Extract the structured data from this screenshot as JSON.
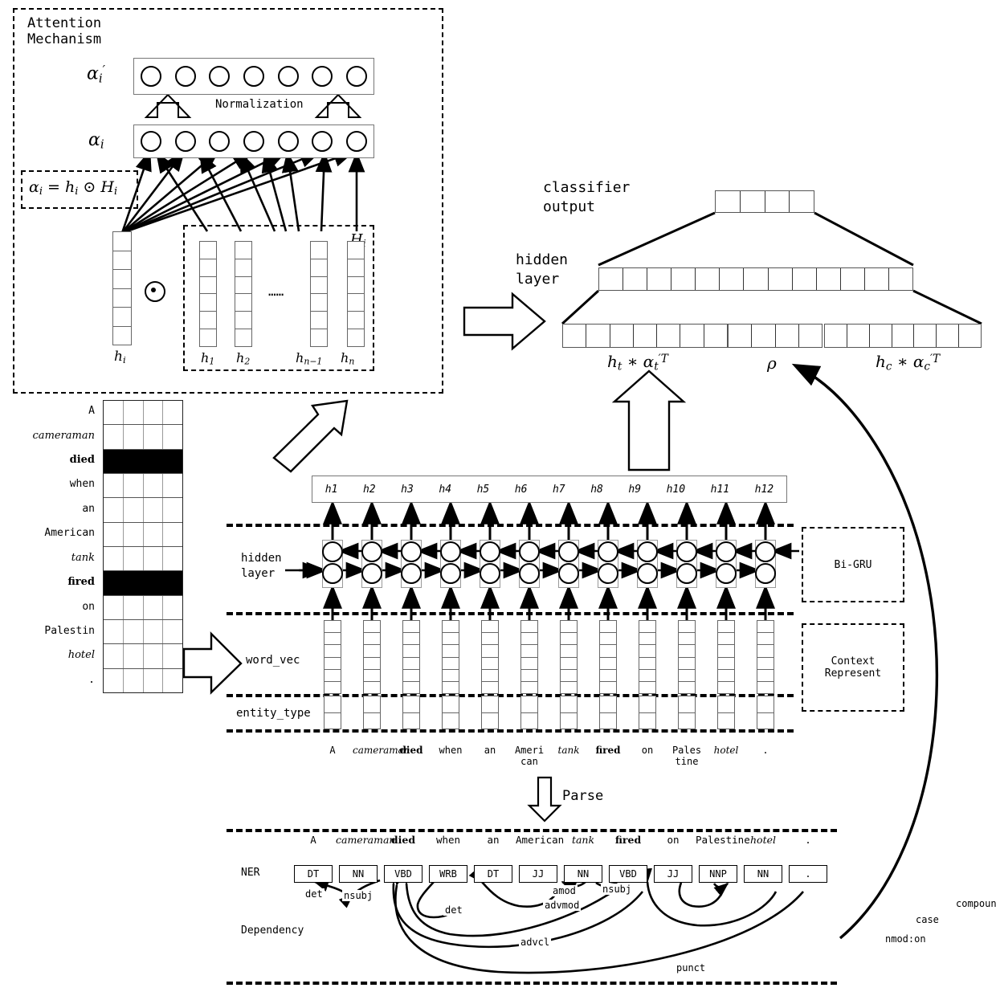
{
  "figure": {
    "title_none": "",
    "attention": {
      "panel_label": "Attention\nMechanism",
      "alpha_prime_label": "α i ′",
      "alpha_label": "α i",
      "normalization_label": "Normalization",
      "formula": "α i = h i ⊙ H i",
      "hadamard_symbol": "⊙",
      "h_i_label": "h i",
      "H_i_label": "H i",
      "ellipsis": "……",
      "alpha_prime_circles": 7,
      "alpha_circles": 7,
      "h_vector_cells": 6,
      "context_vector_labels": [
        "h 1",
        "h 2",
        "h n−1",
        "h n"
      ]
    },
    "classifier": {
      "classifier_output_label": "classifier\noutput",
      "hidden_layer_label": "hidden\nlayer",
      "output_cells": 4,
      "hidden_cells": 13,
      "input_blocks": [
        {
          "label": "h t * α t ′T",
          "cells": 7
        },
        {
          "label": "ρ",
          "cells": 4
        },
        {
          "label": "h c * α c ′T",
          "cells": 7
        }
      ]
    },
    "input_matrix": {
      "rows": 12,
      "cols": 4,
      "words": [
        "A",
        "cameraman",
        "died",
        "when",
        "an",
        "American",
        "tank",
        "fired",
        "on",
        "Palestin",
        "hotel",
        "."
      ],
      "styles": [
        "plain",
        "italic",
        "bold",
        "plain",
        "plain",
        "plain",
        "italic",
        "bold",
        "plain",
        "plain",
        "italic",
        "plain"
      ],
      "highlighted_rows": [
        2,
        7
      ]
    },
    "bigru": {
      "hidden_layer_label": "hidden\nlayer",
      "word_vec_label": "word_vec",
      "entity_type_label": "entity_type",
      "h_outputs": [
        "h1",
        "h2",
        "h3",
        "h4",
        "h5",
        "h6",
        "h7",
        "h8",
        "h9",
        "h10",
        "h11",
        "h12"
      ],
      "side_box_bigru": "Bi-GRU",
      "side_box_context": "Context\nRepresent",
      "word_vec_cells": 6,
      "entity_type_cells": 2,
      "timesteps": 12
    },
    "sentence_wrapped": [
      {
        "text": "A",
        "style": "plain"
      },
      {
        "text": "cameraman",
        "style": "italic"
      },
      {
        "text": "died",
        "style": "bold"
      },
      {
        "text": "when",
        "style": "plain"
      },
      {
        "text": "an",
        "style": "plain"
      },
      {
        "text": "Ameri\ncan",
        "style": "plain"
      },
      {
        "text": "tank",
        "style": "italic"
      },
      {
        "text": "fired",
        "style": "bold"
      },
      {
        "text": "on",
        "style": "plain"
      },
      {
        "text": "Pales\ntine",
        "style": "plain"
      },
      {
        "text": "hotel",
        "style": "italic"
      },
      {
        "text": ".",
        "style": "plain"
      }
    ],
    "parse_label": "Parse",
    "parse_section": {
      "sentence": [
        {
          "text": "A",
          "style": "plain"
        },
        {
          "text": "cameraman",
          "style": "italic"
        },
        {
          "text": "died",
          "style": "bold"
        },
        {
          "text": "when",
          "style": "plain"
        },
        {
          "text": "an",
          "style": "plain"
        },
        {
          "text": "American",
          "style": "plain"
        },
        {
          "text": "tank",
          "style": "italic"
        },
        {
          "text": "fired",
          "style": "bold"
        },
        {
          "text": "on",
          "style": "plain"
        },
        {
          "text": "Palestine",
          "style": "plain"
        },
        {
          "text": "hotel",
          "style": "italic"
        },
        {
          "text": ".",
          "style": "plain"
        }
      ],
      "ner_row_label": "NER",
      "ner_tags": [
        "DT",
        "NN",
        "VBD",
        "WRB",
        "DT",
        "JJ",
        "NN",
        "VBD",
        "JJ",
        "NNP",
        "NN",
        "."
      ],
      "dependency_row_label": "Dependency",
      "dependency_labels": [
        "det",
        "nsubj",
        "amod",
        "nsubj",
        "det",
        "advmod",
        "advcl",
        "case",
        "nmod:on",
        "compound",
        "punct"
      ]
    },
    "colors": {
      "stroke": "#000000",
      "cell_border": "#555555",
      "highlight_fill": "#000000",
      "background": "#ffffff"
    }
  }
}
